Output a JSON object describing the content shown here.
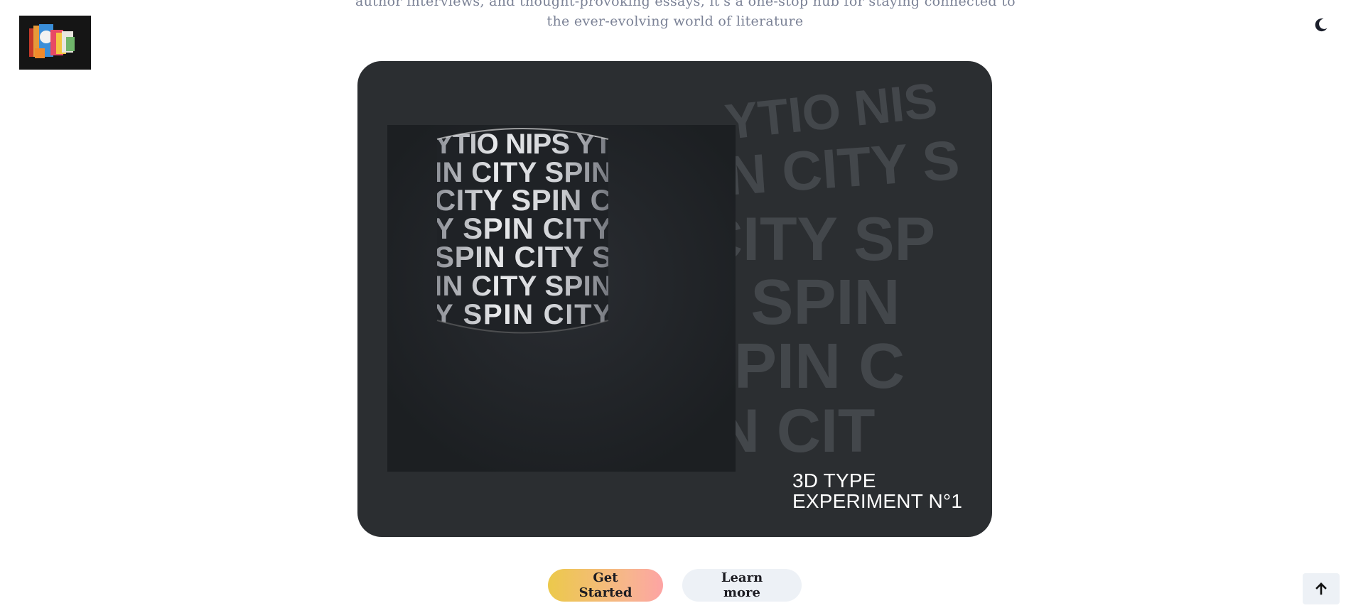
{
  "intro": {
    "line1": "author interviews, and thought-provoking essays, it's a one-stop hub for staying connected to",
    "line2": "the ever-evolving world of literature"
  },
  "logo": {
    "icon": "collage-logo-icon"
  },
  "theme_toggle": {
    "icon": "moon-icon"
  },
  "hero": {
    "image_text": "SPIN CITY",
    "caption_line1": "3D TYPE",
    "caption_line2": "EXPERIMENT  N°1"
  },
  "cta": {
    "primary_label": "Get Started",
    "secondary_label": "Learn more"
  },
  "scroll_top": {
    "icon": "arrow-up-icon"
  },
  "colors": {
    "hero_bg": "#2b2e31",
    "intro_text": "#7b8296",
    "primary_gradient_start": "#ecc94b",
    "primary_gradient_end": "#fda4a4",
    "secondary_bg": "#edf1f6"
  }
}
